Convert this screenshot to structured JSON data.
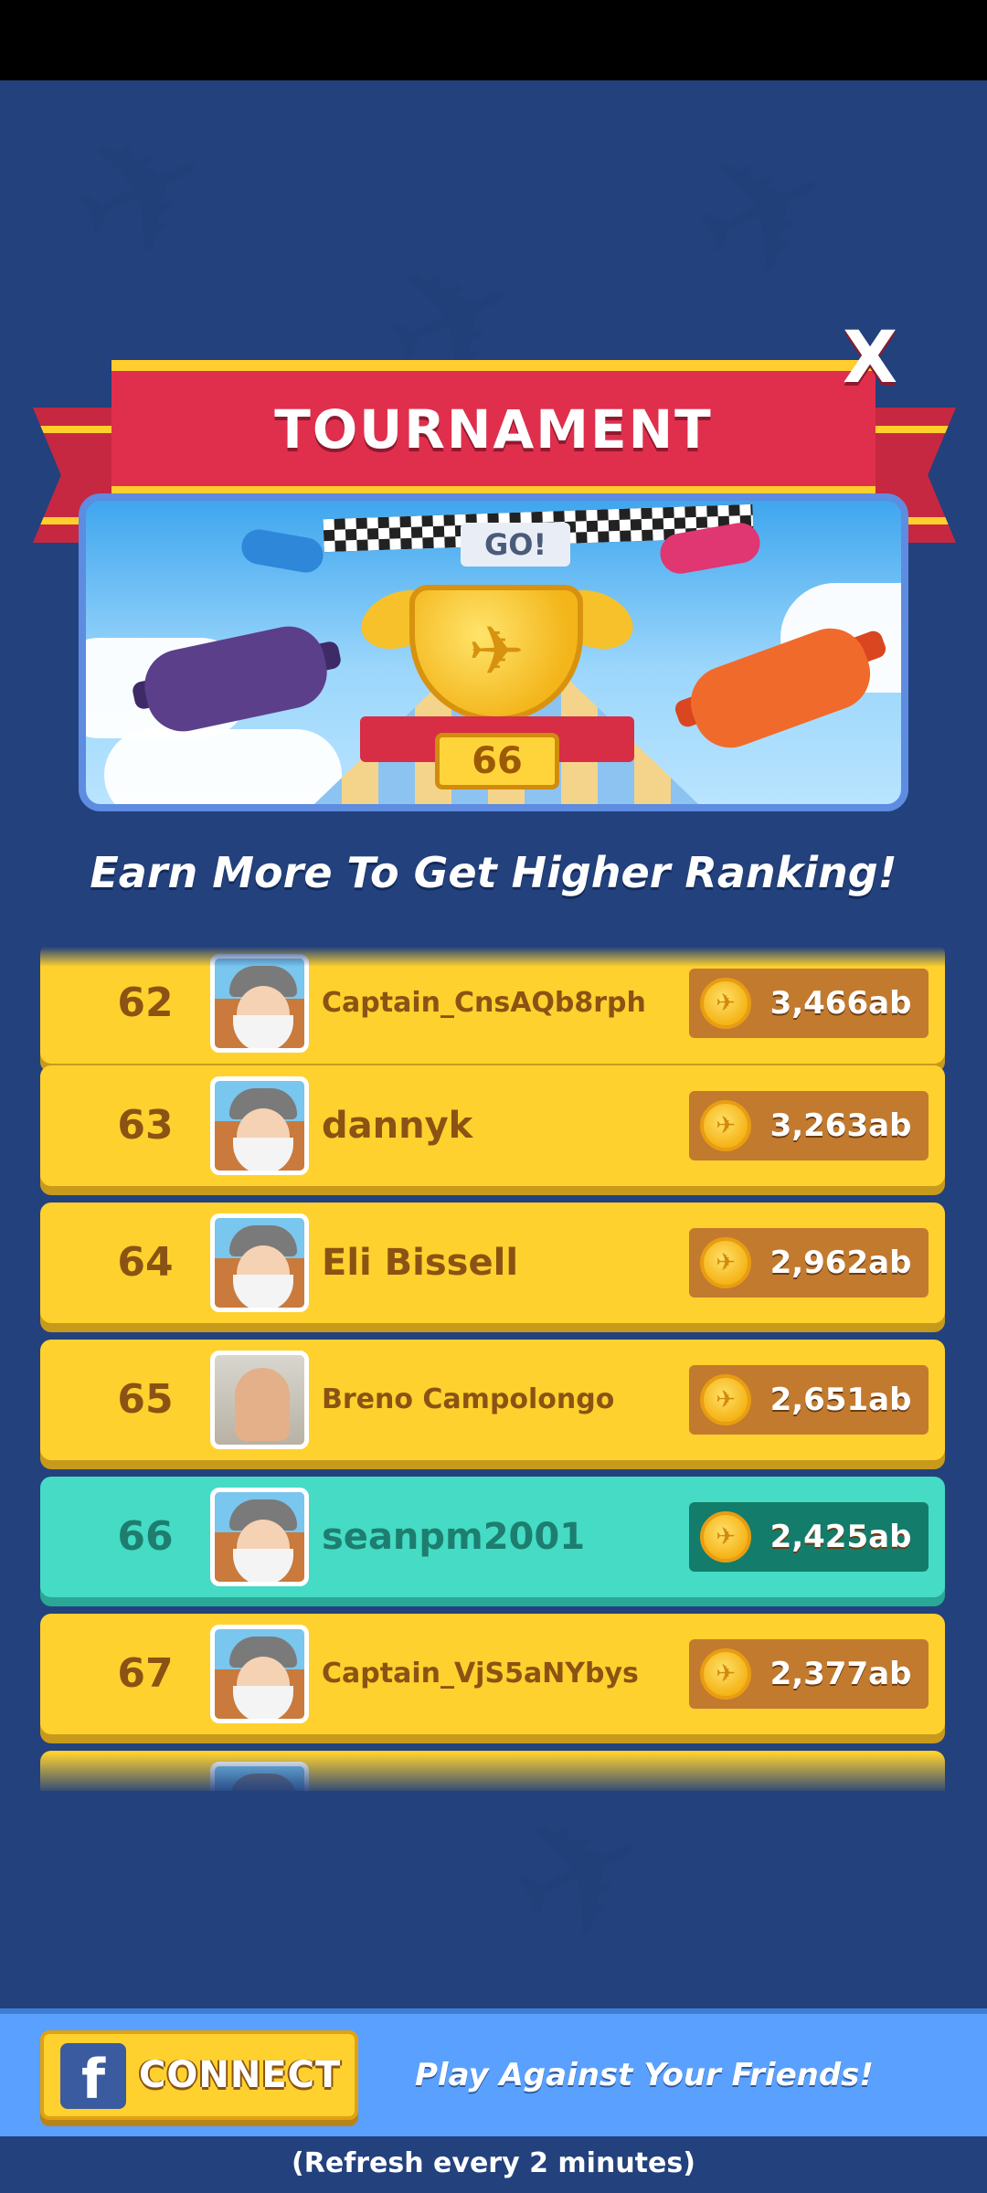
{
  "header": {
    "title": "TOURNAMENT",
    "close_label": "X"
  },
  "banner": {
    "go_text": "GO!",
    "trophy_rank": "66"
  },
  "subtitle": "Earn More To Get Higher Ranking!",
  "leaderboard": [
    {
      "rank": "62",
      "name": "Captain_CnsAQb8rph",
      "score": "3,466ab",
      "avatar": "pilot-avatar",
      "highlight": false
    },
    {
      "rank": "63",
      "name": "dannyk",
      "score": "3,263ab",
      "avatar": "pilot-avatar",
      "highlight": false
    },
    {
      "rank": "64",
      "name": "Eli Bissell",
      "score": "2,962ab",
      "avatar": "pilot-avatar",
      "highlight": false
    },
    {
      "rank": "65",
      "name": "Breno Campolongo",
      "score": "2,651ab",
      "avatar": "photo-avatar",
      "highlight": false
    },
    {
      "rank": "66",
      "name": "seanpm2001",
      "score": "2,425ab",
      "avatar": "pilot-avatar",
      "highlight": true
    },
    {
      "rank": "67",
      "name": "Captain_VjS5aNYbys",
      "score": "2,377ab",
      "avatar": "pilot-avatar",
      "highlight": false
    }
  ],
  "footer": {
    "connect_icon": "facebook-icon",
    "connect_icon_glyph": "f",
    "connect_label": "CONNECT",
    "friends_text": "Play Against Your Friends!",
    "refresh_text": "(Refresh every 2 minutes)"
  },
  "colors": {
    "background": "#23417c",
    "ribbon": "#e02f4d",
    "row": "#ffd12e",
    "row_highlight": "#45dbc4",
    "score_box": "#c27a2f",
    "score_box_highlight": "#137c6a",
    "bottom_bar": "#5aa1ff"
  }
}
